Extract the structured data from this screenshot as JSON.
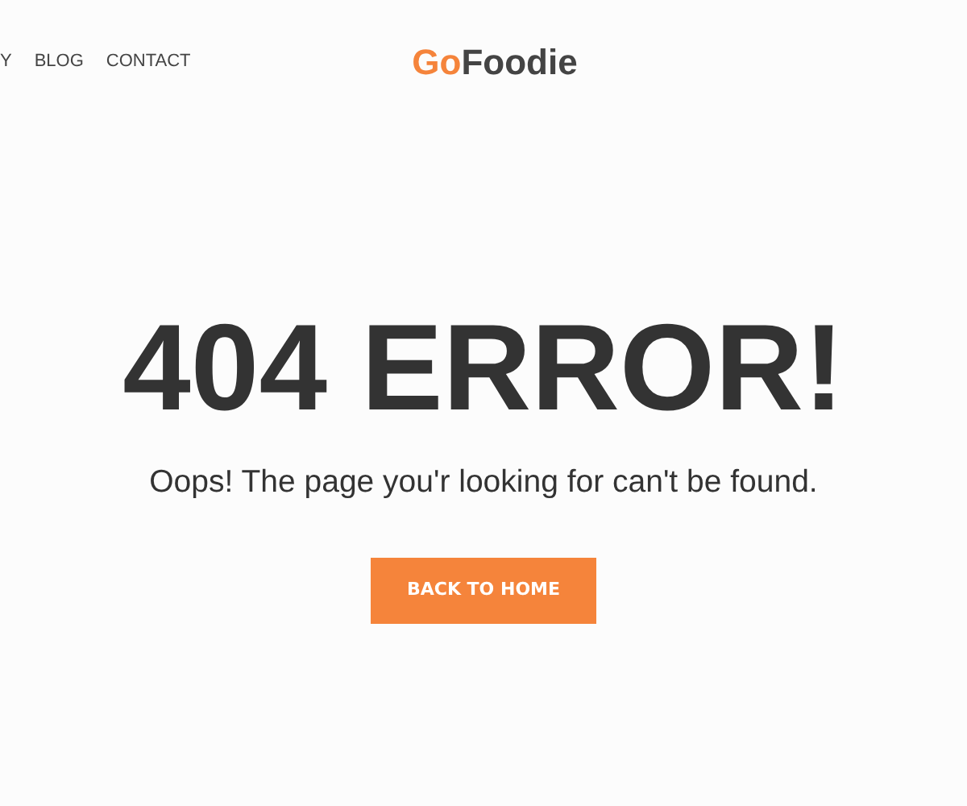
{
  "nav": {
    "links": [
      "Y",
      "BLOG",
      "CONTACT"
    ]
  },
  "logo": {
    "accent": "Go",
    "rest": "Foodie"
  },
  "error": {
    "title": "404 ERROR!",
    "message": "Oops! The page you'r looking for can't be found.",
    "button": "BACK TO HOME"
  }
}
